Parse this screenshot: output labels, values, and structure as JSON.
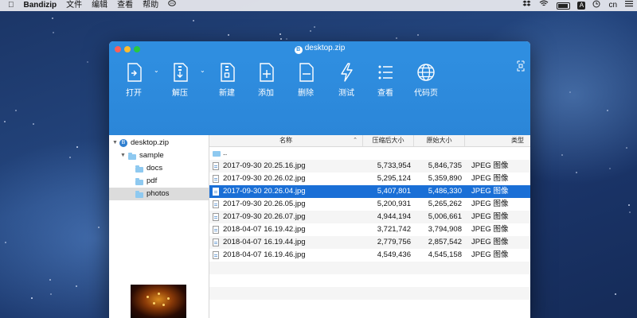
{
  "menubar": {
    "apple": "",
    "app_name": "Bandizip",
    "items": [
      "文件",
      "编辑",
      "查看",
      "帮助"
    ],
    "input_source": "A",
    "language": "cn"
  },
  "window": {
    "title": "desktop.zip",
    "toolbar": [
      {
        "label": "打开",
        "icon": "open-archive-icon"
      },
      {
        "label": "解压",
        "icon": "extract-icon"
      },
      {
        "label": "新建",
        "icon": "new-archive-icon"
      },
      {
        "label": "添加",
        "icon": "add-file-icon"
      },
      {
        "label": "删除",
        "icon": "delete-file-icon"
      },
      {
        "label": "测试",
        "icon": "test-archive-icon"
      },
      {
        "label": "查看",
        "icon": "view-list-icon"
      },
      {
        "label": "代码页",
        "icon": "codepage-globe-icon"
      }
    ]
  },
  "tree": {
    "items": [
      {
        "label": "desktop.zip",
        "level": 0,
        "kind": "zip",
        "expanded": true
      },
      {
        "label": "sample",
        "level": 1,
        "kind": "folder",
        "expanded": true
      },
      {
        "label": "docs",
        "level": 2,
        "kind": "folder"
      },
      {
        "label": "pdf",
        "level": 2,
        "kind": "folder"
      },
      {
        "label": "photos",
        "level": 2,
        "kind": "folder",
        "selected": true
      }
    ]
  },
  "list": {
    "columns": {
      "name": "名称",
      "packed": "压缩后大小",
      "original": "原始大小",
      "type": "类型"
    },
    "parent": "..",
    "rows": [
      {
        "name": "2017-09-30 20.25.16.jpg",
        "packed": "5,733,954",
        "original": "5,846,735",
        "type": "JPEG 图像"
      },
      {
        "name": "2017-09-30 20.26.02.jpg",
        "packed": "5,295,124",
        "original": "5,359,890",
        "type": "JPEG 图像"
      },
      {
        "name": "2017-09-30 20.26.04.jpg",
        "packed": "5,407,801",
        "original": "5,486,330",
        "type": "JPEG 图像",
        "selected": true
      },
      {
        "name": "2017-09-30 20.26.05.jpg",
        "packed": "5,200,931",
        "original": "5,265,262",
        "type": "JPEG 图像"
      },
      {
        "name": "2017-09-30 20.26.07.jpg",
        "packed": "4,944,194",
        "original": "5,006,661",
        "type": "JPEG 图像"
      },
      {
        "name": "2018-04-07 16.19.42.jpg",
        "packed": "3,721,742",
        "original": "3,794,908",
        "type": "JPEG 图像"
      },
      {
        "name": "2018-04-07 16.19.44.jpg",
        "packed": "2,779,756",
        "original": "2,857,542",
        "type": "JPEG 图像"
      },
      {
        "name": "2018-04-07 16.19.46.jpg",
        "packed": "4,549,436",
        "original": "4,545,158",
        "type": "JPEG 图像"
      }
    ]
  }
}
